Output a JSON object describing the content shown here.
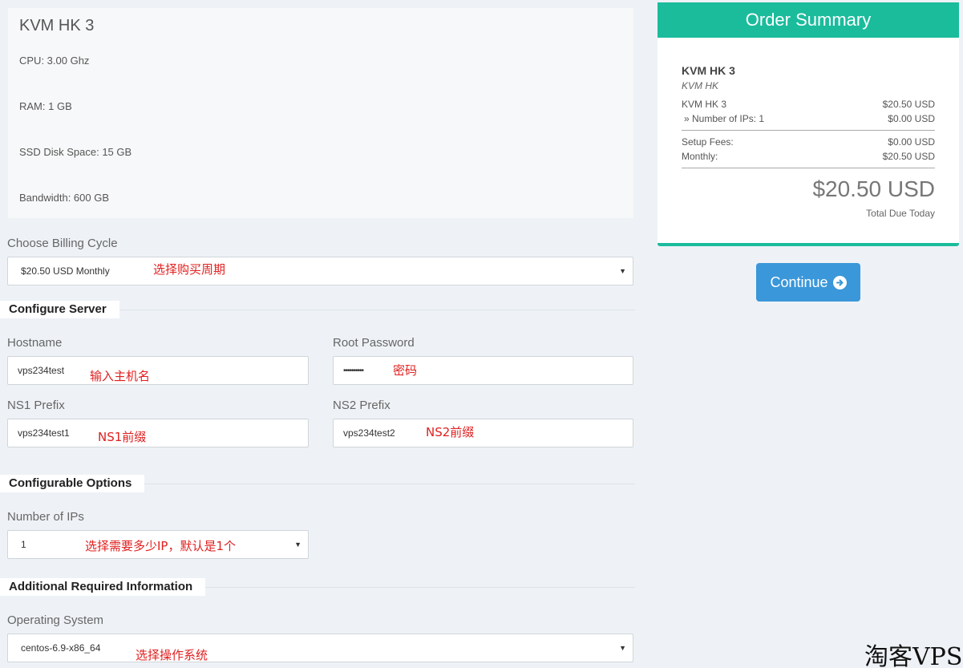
{
  "product": {
    "title": "KVM HK 3",
    "specs": [
      "CPU: 3.00 Ghz",
      "RAM: 1 GB",
      "SSD Disk Space: 15 GB",
      "Bandwidth: 600 GB"
    ]
  },
  "billing": {
    "label": "Choose Billing Cycle",
    "value": "$20.50 USD Monthly",
    "annotation": "选择购买周期"
  },
  "configure_server": {
    "heading": "Configure Server",
    "hostname": {
      "label": "Hostname",
      "value": "vps234test",
      "annotation": "输入主机名"
    },
    "root_password": {
      "label": "Root Password",
      "value": "••••••••••",
      "annotation": "密码"
    },
    "ns1": {
      "label": "NS1 Prefix",
      "value": "vps234test1",
      "annotation": "NS1前缀"
    },
    "ns2": {
      "label": "NS2 Prefix",
      "value": "vps234test2",
      "annotation": "NS2前缀"
    }
  },
  "configurable_options": {
    "heading": "Configurable Options",
    "ips": {
      "label": "Number of IPs",
      "value": "1",
      "annotation": "选择需要多少IP，默认是1个"
    }
  },
  "additional_info": {
    "heading": "Additional Required Information",
    "os": {
      "label": "Operating System",
      "value": "centos-6.9-x86_64",
      "annotation": "选择操作系统"
    }
  },
  "summary": {
    "header": "Order Summary",
    "product_name": "KVM HK 3",
    "product_group": "KVM HK",
    "lines": [
      {
        "label": "KVM HK 3",
        "amount": "$20.50 USD"
      },
      {
        "label": "» Number of IPs: 1",
        "amount": "$0.00 USD"
      }
    ],
    "fees": [
      {
        "label": "Setup Fees:",
        "amount": "$0.00 USD"
      },
      {
        "label": "Monthly:",
        "amount": "$20.50 USD"
      }
    ],
    "total": "$20.50 USD",
    "total_caption": "Total Due Today"
  },
  "continue_label": "Continue",
  "watermark": "淘客VPS",
  "colors": {
    "accent": "#1abc9c",
    "button": "#3a97d9",
    "annotation": "#e02020"
  },
  "icons": {
    "continue": "arrow-circle-right-icon",
    "select": "caret-down-icon"
  }
}
